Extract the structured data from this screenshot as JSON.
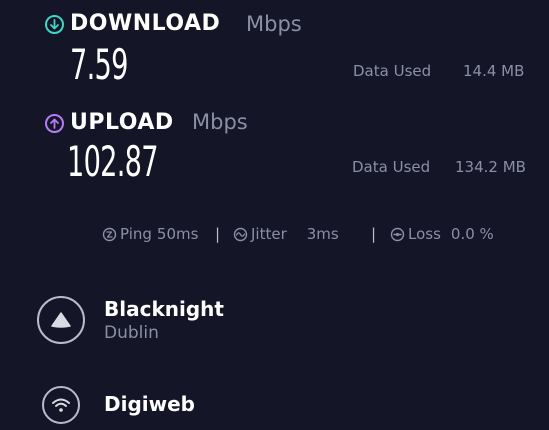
{
  "download": {
    "label": "DOWNLOAD",
    "unit": "Mbps",
    "value": "7.59",
    "data_used_label": "Data Used",
    "data_used_value": "14.4 MB",
    "accent": "#3fd5c8"
  },
  "upload": {
    "label": "UPLOAD",
    "unit": "Mbps",
    "value": "102.87",
    "data_used_label": "Data Used",
    "data_used_value": "134.2 MB",
    "accent": "#b57cf4"
  },
  "stats": {
    "ping_label": "Ping",
    "ping_value": "50ms",
    "jitter_label": "Jitter",
    "jitter_value": "3ms",
    "loss_label": "Loss",
    "loss_value": "0.0 %",
    "separator": "|"
  },
  "servers": [
    {
      "name": "Blacknight",
      "location": "Dublin",
      "icon": "server-triangle-icon"
    },
    {
      "name": "Digiweb",
      "location": "",
      "icon": "wifi-icon"
    }
  ]
}
